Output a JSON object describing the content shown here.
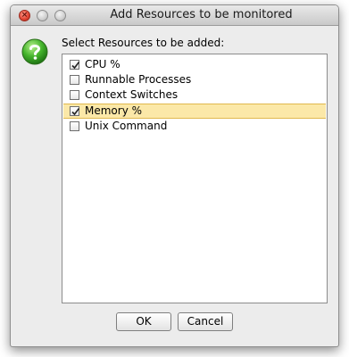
{
  "window": {
    "title": "Add Resources to be monitored"
  },
  "dialog": {
    "icon": "help-question-icon",
    "prompt": "Select Resources to be added:",
    "items": [
      {
        "label": "CPU %",
        "checked": true,
        "selected": false
      },
      {
        "label": "Runnable Processes",
        "checked": false,
        "selected": false
      },
      {
        "label": "Context Switches",
        "checked": false,
        "selected": false
      },
      {
        "label": "Memory %",
        "checked": true,
        "selected": true
      },
      {
        "label": "Unix Command",
        "checked": false,
        "selected": false
      }
    ]
  },
  "buttons": {
    "ok_label": "OK",
    "cancel_label": "Cancel"
  },
  "colors": {
    "selection_bg": "#fbe8a8",
    "help_icon_green": "#3fae2a"
  }
}
